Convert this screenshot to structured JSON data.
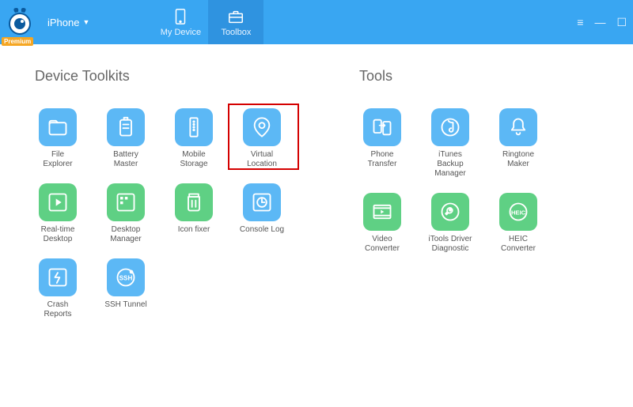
{
  "device": "iPhone",
  "badge": "Premium",
  "tabs": {
    "my_device": "My Device",
    "toolbox": "Toolbox"
  },
  "sections": {
    "device_toolkits": "Device Toolkits",
    "tools": "Tools"
  },
  "device_toolkits": [
    {
      "key": "file-explorer",
      "label": "File\nExplorer",
      "color": "blue"
    },
    {
      "key": "battery-master",
      "label": "Battery Master",
      "color": "blue"
    },
    {
      "key": "mobile-storage",
      "label": "Mobile Storage",
      "color": "blue"
    },
    {
      "key": "virtual-location",
      "label": "Virtual Location",
      "color": "blue",
      "highlight": true
    },
    {
      "key": "real-time-desktop",
      "label": "Real-time\nDesktop",
      "color": "green"
    },
    {
      "key": "desktop-manager",
      "label": "Desktop\nManager",
      "color": "green"
    },
    {
      "key": "icon-fixer",
      "label": "Icon fixer",
      "color": "green"
    },
    {
      "key": "console-log",
      "label": "Console Log",
      "color": "blue"
    },
    {
      "key": "crash-reports",
      "label": "Crash Reports",
      "color": "blue"
    },
    {
      "key": "ssh-tunnel",
      "label": "SSH Tunnel",
      "color": "blue"
    }
  ],
  "tools": [
    {
      "key": "phone-transfer",
      "label": "Phone Transfer",
      "color": "blue"
    },
    {
      "key": "itunes-backup-manager",
      "label": "iTunes Backup\nManager",
      "color": "blue"
    },
    {
      "key": "ringtone-maker",
      "label": "Ringtone Maker",
      "color": "blue"
    },
    {
      "key": "video-converter",
      "label": "Video\nConverter",
      "color": "green"
    },
    {
      "key": "itools-driver-diagnostic",
      "label": "iTools Driver\nDiagnostic",
      "color": "green"
    },
    {
      "key": "heic-converter",
      "label": "HEIC Converter",
      "color": "green"
    }
  ],
  "colors": {
    "blue": "#5cb8f5",
    "green": "#5fd084"
  }
}
